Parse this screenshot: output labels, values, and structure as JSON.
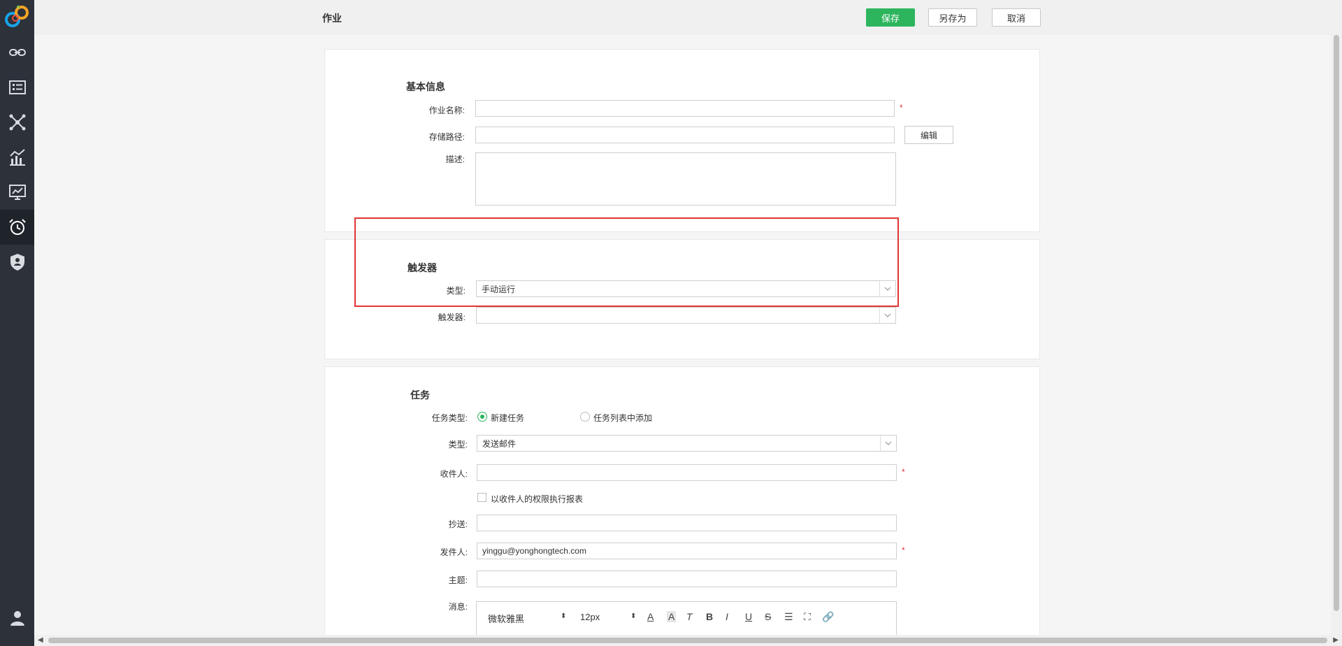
{
  "header": {
    "title": "作业",
    "save": "保存",
    "save_as": "另存为",
    "cancel": "取消"
  },
  "sidebar": {
    "items": [
      {
        "icon": "link-icon"
      },
      {
        "icon": "list-icon"
      },
      {
        "icon": "network-icon"
      },
      {
        "icon": "chart-icon"
      },
      {
        "icon": "presentation-icon"
      },
      {
        "icon": "alarm-clock-icon",
        "active": true
      },
      {
        "icon": "shield-user-icon"
      },
      {
        "icon": "user-icon"
      }
    ]
  },
  "basic_info": {
    "title": "基本信息",
    "name_label": "作业名称:",
    "path_label": "存储路径:",
    "edit_btn": "编辑",
    "desc_label": "描述:",
    "name_value": "",
    "path_value": ""
  },
  "trigger": {
    "title": "触发器",
    "type_label": "类型:",
    "type_value": "手动运行",
    "trigger_label": "触发器:",
    "trigger_value": ""
  },
  "task": {
    "title": "任务",
    "task_type_label": "任务类型:",
    "option_new": "新建任务",
    "option_list": "任务列表中添加",
    "type_label": "类型:",
    "type_value": "发送邮件",
    "to_label": "收件人:",
    "permission_check": "以收件人的权限执行报表",
    "cc_label": "抄送:",
    "from_label": "发件人:",
    "from_value": "yinggu@yonghongtech.com",
    "subject_label": "主题:",
    "message_label": "消息:",
    "editor_font": "微软雅黑",
    "editor_size": "12px"
  },
  "colors": {
    "accent": "#2db55d",
    "highlight": "#e23434",
    "sidebar": "#2c313a"
  }
}
